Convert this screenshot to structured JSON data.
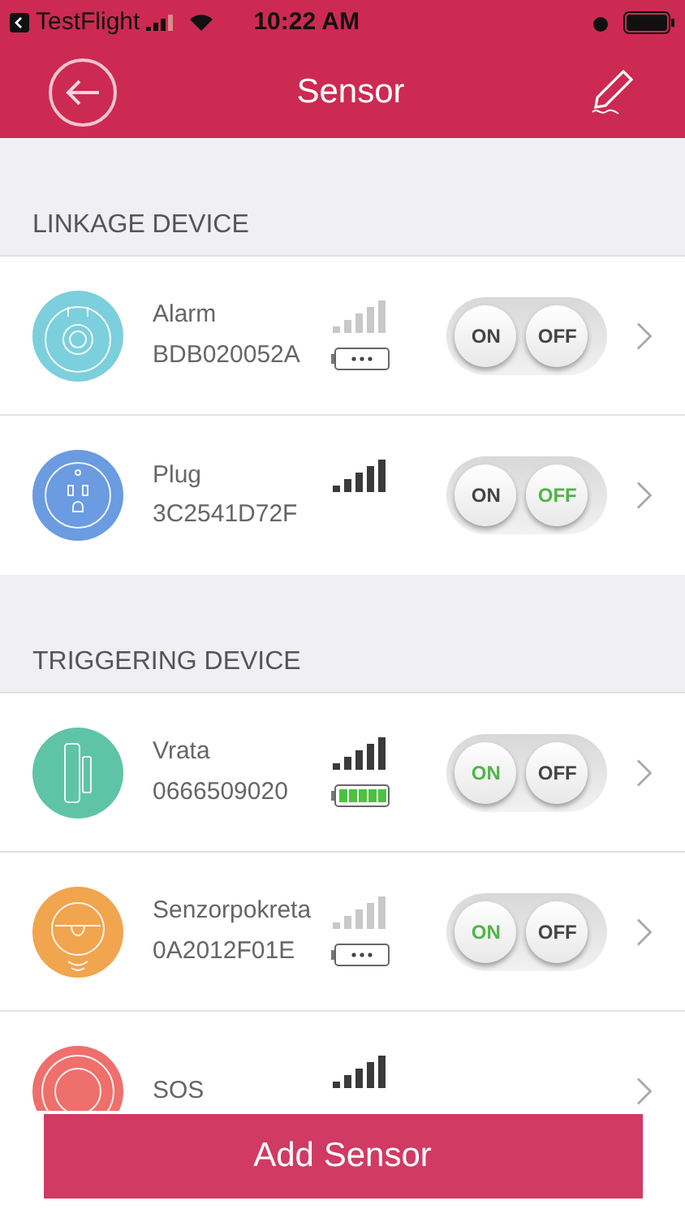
{
  "status_bar": {
    "back_app": "TestFlight",
    "time": "10:22 AM"
  },
  "header": {
    "title": "Sensor"
  },
  "sections": [
    {
      "title": "LINKAGE DEVICE",
      "devices": [
        {
          "kind": "alarm",
          "color": "#7ccfdc",
          "name": "Alarm",
          "id": "BDB020052A",
          "signal_weak": true,
          "battery_shown": true,
          "battery_full": false,
          "on_button": {
            "label": "ON",
            "selected": false
          },
          "off_button": {
            "label": "OFF",
            "selected": false
          }
        },
        {
          "kind": "plug",
          "color": "#6b9be0",
          "name": "Plug",
          "id": "3C2541D72F",
          "signal_weak": false,
          "battery_shown": false,
          "on_button": {
            "label": "ON",
            "selected": false
          },
          "off_button": {
            "label": "OFF",
            "selected": true
          }
        }
      ]
    },
    {
      "title": "TRIGGERING DEVICE",
      "devices": [
        {
          "kind": "door",
          "color": "#5fc4a6",
          "name": "Vrata",
          "id": "0666509020",
          "signal_weak": false,
          "battery_shown": true,
          "battery_full": true,
          "on_button": {
            "label": "ON",
            "selected": true
          },
          "off_button": {
            "label": "OFF",
            "selected": false
          }
        },
        {
          "kind": "motion",
          "color": "#f0a54e",
          "name": "Senzorpokreta",
          "id": "0A2012F01E",
          "signal_weak": true,
          "battery_shown": true,
          "battery_full": false,
          "on_button": {
            "label": "ON",
            "selected": true
          },
          "off_button": {
            "label": "OFF",
            "selected": false
          }
        },
        {
          "kind": "sos",
          "color": "#ee6f6c",
          "name": "SOS",
          "signal_weak": false,
          "battery_shown": false
        }
      ]
    }
  ],
  "add_button": "Add Sensor"
}
